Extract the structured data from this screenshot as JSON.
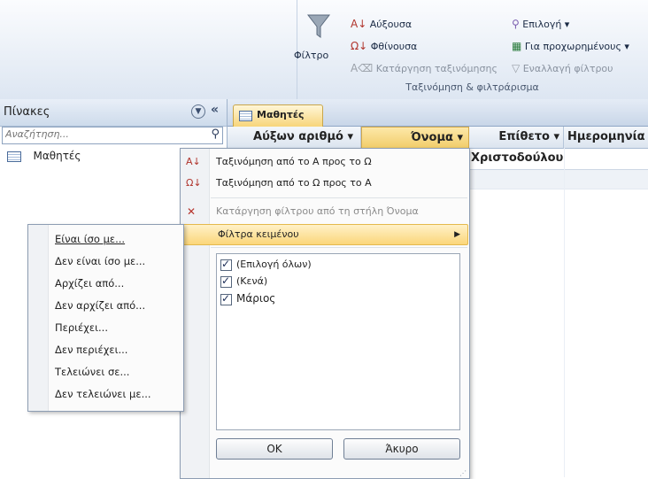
{
  "ribbon": {
    "filter_label": "Φίλτρο",
    "ascending": "Αύξουσα",
    "descending": "Φθίνουσα",
    "clear_sort": "Κατάργηση ταξινόμησης",
    "selection": "Επιλογή ▾",
    "advanced": "Για προχωρημένους ▾",
    "toggle_filter": "Εναλλαγή φίλτρου",
    "group_label": "Ταξινόμηση & φιλτράρισμα"
  },
  "nav": {
    "title": "Πίνακες",
    "search_placeholder": "Αναζήτηση...",
    "items": [
      {
        "label": "Μαθητές"
      }
    ]
  },
  "datasheet": {
    "tab_label": "Μαθητές",
    "columns": [
      "Αύξων αριθμό ▾",
      "Όνομα ▾",
      "Επίθετο ▾",
      "Ημερομηνία"
    ],
    "cell_value": "Χριστοδούλου"
  },
  "menu": {
    "sort_asc": "Ταξινόμηση από το Α προς το Ω",
    "sort_desc": "Ταξινόμηση από το Ω προς το Α",
    "clear_filter": "Κατάργηση φίλτρου από τη στήλη Όνομα",
    "text_filters": "Φίλτρα κειμένου",
    "checklist": [
      {
        "label": "(Επιλογή όλων)",
        "checked": true
      },
      {
        "label": "(Κενά)",
        "checked": true
      },
      {
        "label": "Μάριος",
        "checked": true
      }
    ],
    "ok_label": "OK",
    "cancel_label": "Άκυρο"
  },
  "submenu": {
    "items": [
      "Είναι ίσο με...",
      "Δεν είναι ίσο με...",
      "Αρχίζει από...",
      "Δεν αρχίζει από...",
      "Περιέχει...",
      "Δεν περιέχει...",
      "Τελειώνει σε...",
      "Δεν τελειώνει με..."
    ]
  }
}
